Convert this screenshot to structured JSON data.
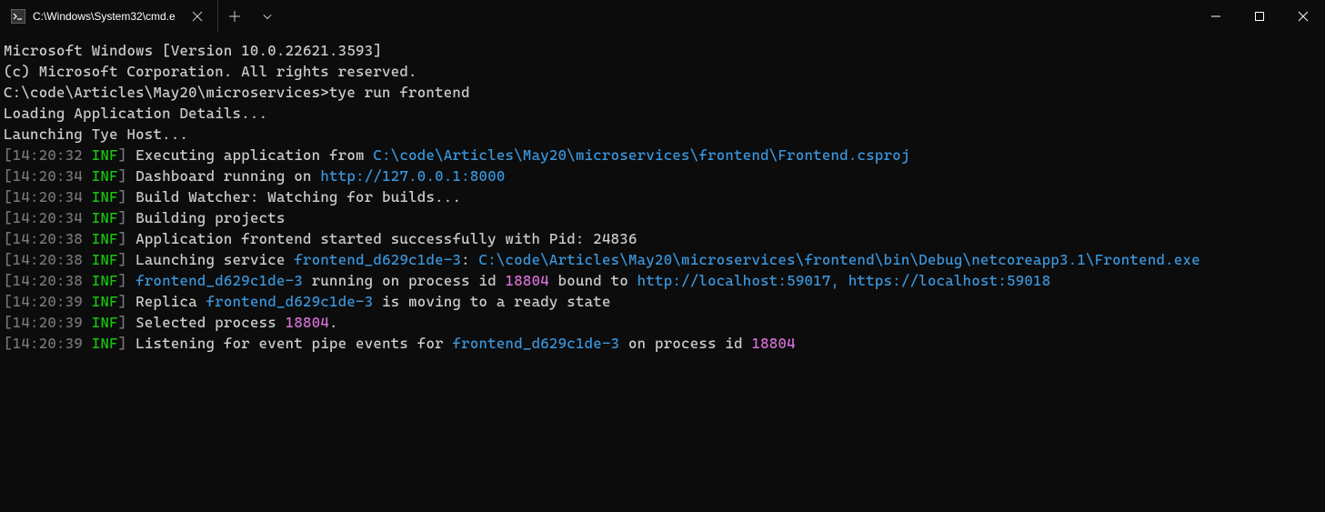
{
  "titlebar": {
    "tab_title": "C:\\Windows\\System32\\cmd.e"
  },
  "terminal": {
    "header1": "Microsoft Windows [Version 10.0.22621.3593]",
    "header2": "(c) Microsoft Corporation. All rights reserved.",
    "prompt": "C:\\code\\Articles\\May20\\microservices>",
    "command": "tye run frontend",
    "loading1": "Loading Application Details...",
    "loading2": "Launching Tye Host...",
    "lines": [
      {
        "time": "14:20:32",
        "level": "INF",
        "segments": [
          {
            "text": "Executing application from ",
            "color": "white"
          },
          {
            "text": "C:\\code\\Articles\\May20\\microservices\\frontend\\Frontend.csproj",
            "color": "cyan"
          }
        ]
      },
      {
        "time": "14:20:34",
        "level": "INF",
        "segments": [
          {
            "text": "Dashboard running on ",
            "color": "white"
          },
          {
            "text": "http://127.0.0.1:8000",
            "color": "cyan"
          }
        ]
      },
      {
        "time": "14:20:34",
        "level": "INF",
        "segments": [
          {
            "text": "Build Watcher: Watching for builds...",
            "color": "white"
          }
        ]
      },
      {
        "time": "14:20:34",
        "level": "INF",
        "segments": [
          {
            "text": "Building projects",
            "color": "white"
          }
        ]
      },
      {
        "time": "14:20:38",
        "level": "INF",
        "segments": [
          {
            "text": "Application frontend started successfully with Pid: 24836",
            "color": "white"
          }
        ]
      },
      {
        "time": "14:20:38",
        "level": "INF",
        "segments": [
          {
            "text": "Launching service ",
            "color": "white"
          },
          {
            "text": "frontend_d629c1de-3",
            "color": "cyan"
          },
          {
            "text": ": ",
            "color": "white"
          },
          {
            "text": "C:\\code\\Articles\\May20\\microservices\\frontend\\bin\\Debug\\netcoreapp3.1\\Frontend.exe",
            "color": "cyan"
          }
        ]
      },
      {
        "time": "14:20:38",
        "level": "INF",
        "segments": [
          {
            "text": "frontend_d629c1de-3",
            "color": "cyan"
          },
          {
            "text": " running on process id ",
            "color": "white"
          },
          {
            "text": "18804",
            "color": "magenta"
          },
          {
            "text": " bound to ",
            "color": "white"
          },
          {
            "text": "http://localhost:59017, https://localhost:59018",
            "color": "cyan"
          }
        ]
      },
      {
        "time": "14:20:39",
        "level": "INF",
        "segments": [
          {
            "text": "Replica ",
            "color": "white"
          },
          {
            "text": "frontend_d629c1de-3",
            "color": "cyan"
          },
          {
            "text": " is moving to a ready state",
            "color": "white"
          }
        ]
      },
      {
        "time": "14:20:39",
        "level": "INF",
        "segments": [
          {
            "text": "Selected process ",
            "color": "white"
          },
          {
            "text": "18804",
            "color": "magenta"
          },
          {
            "text": ".",
            "color": "white"
          }
        ]
      },
      {
        "time": "14:20:39",
        "level": "INF",
        "segments": [
          {
            "text": "Listening for event pipe events for ",
            "color": "white"
          },
          {
            "text": "frontend_d629c1de-3",
            "color": "cyan"
          },
          {
            "text": " on process id ",
            "color": "white"
          },
          {
            "text": "18804",
            "color": "magenta"
          }
        ]
      }
    ]
  }
}
